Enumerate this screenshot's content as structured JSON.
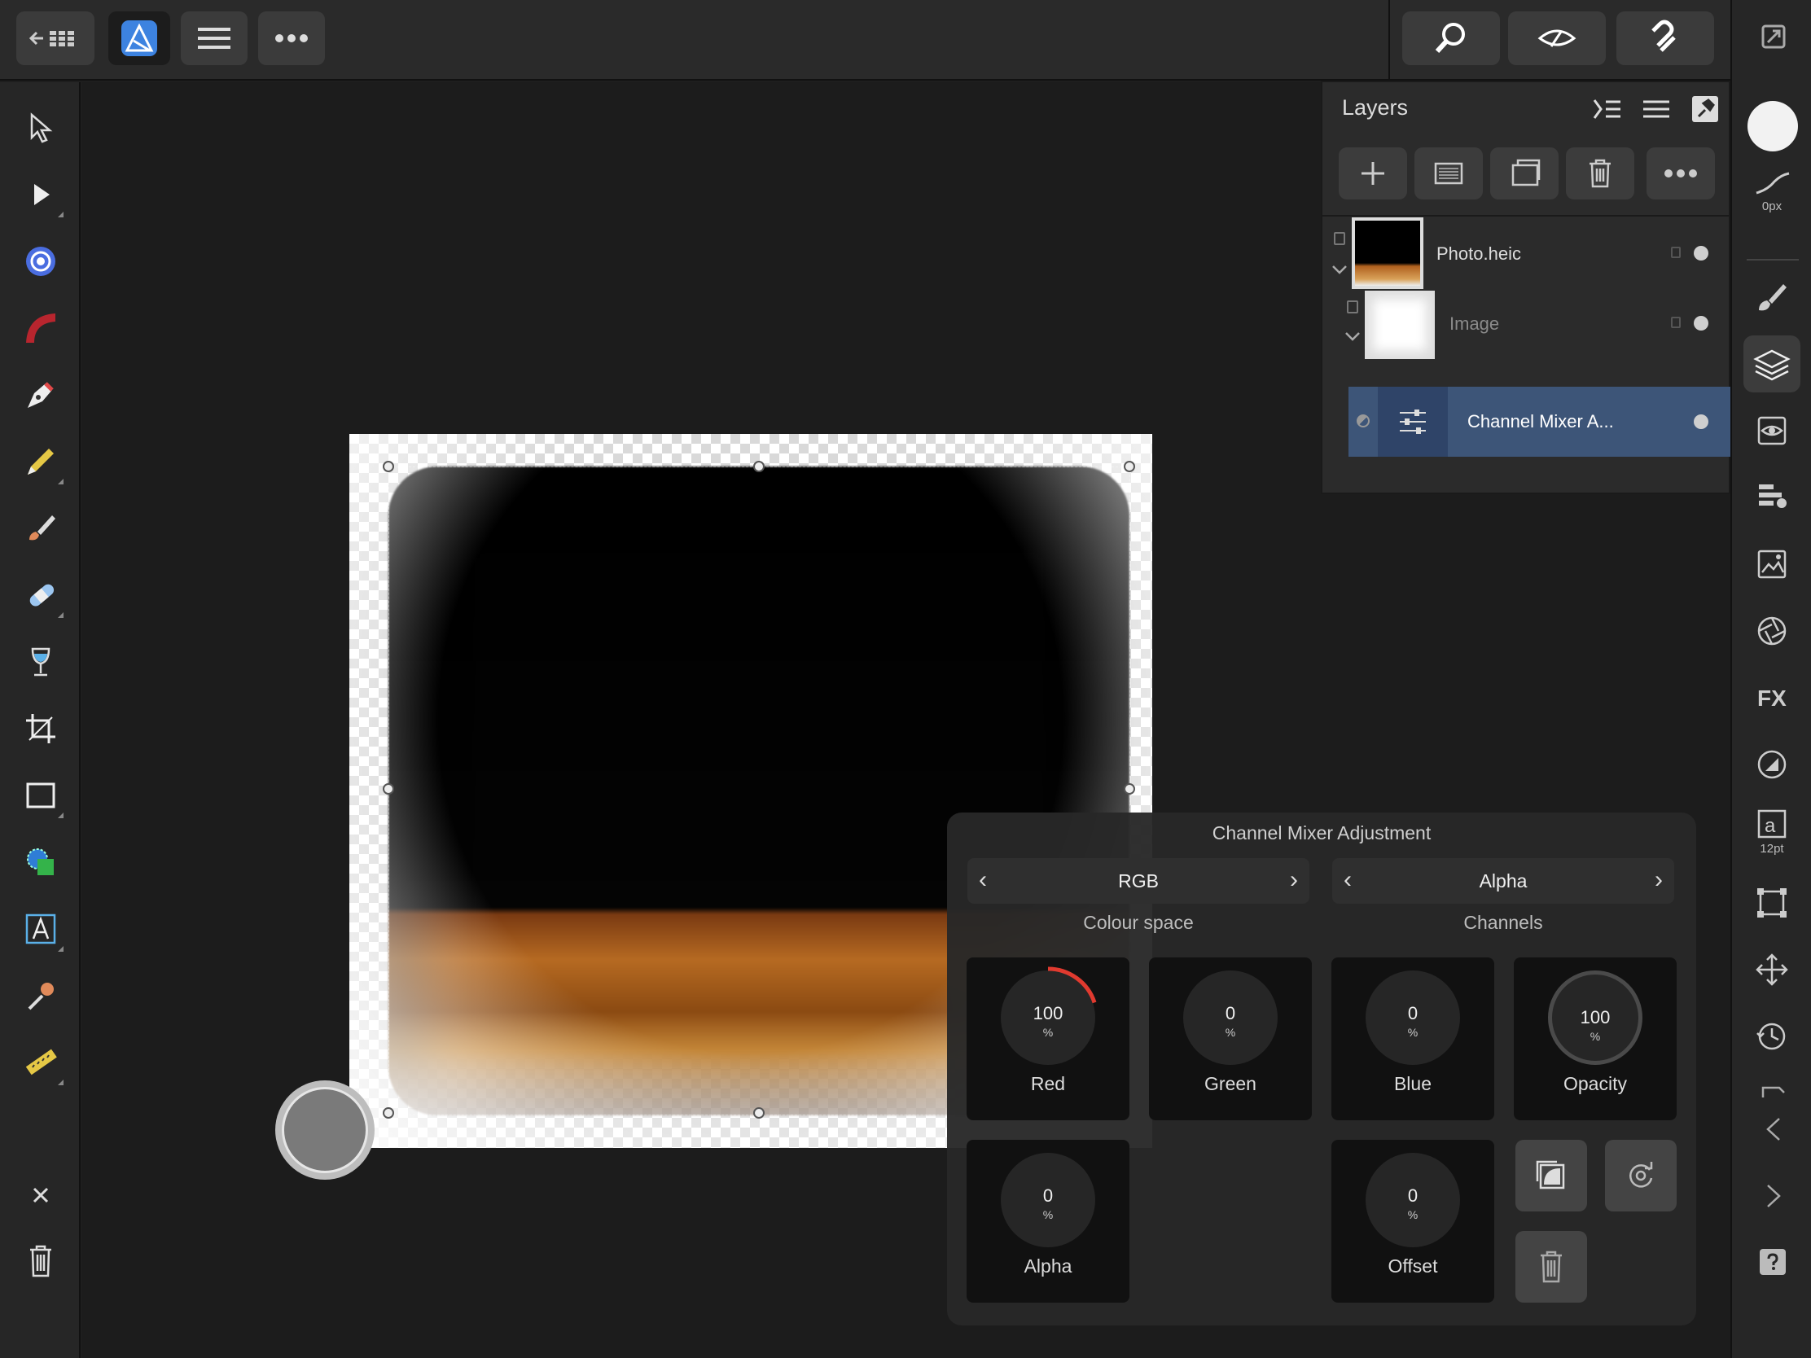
{
  "layers_panel": {
    "title": "Layers",
    "items": [
      {
        "name": "Photo.heic"
      },
      {
        "name": "Image"
      },
      {
        "name": "Channel Mixer A..."
      }
    ]
  },
  "right_bar": {
    "stroke_width": "0px",
    "text_size": "12pt"
  },
  "channel_mixer": {
    "title": "Channel Mixer Adjustment",
    "colour_space": {
      "value": "RGB",
      "caption": "Colour space"
    },
    "channels": {
      "value": "Alpha",
      "caption": "Channels"
    },
    "knobs": [
      {
        "label": "Red",
        "value": "100",
        "unit": "%",
        "level": 0.2
      },
      {
        "label": "Green",
        "value": "0",
        "unit": "%",
        "level": 0
      },
      {
        "label": "Blue",
        "value": "0",
        "unit": "%",
        "level": 0
      },
      {
        "label": "Opacity",
        "value": "100",
        "unit": "%",
        "level": 1
      },
      {
        "label": "Alpha",
        "value": "0",
        "unit": "%",
        "level": 0
      },
      {
        "label": "Offset",
        "value": "0",
        "unit": "%",
        "level": 0
      }
    ]
  },
  "colors": {
    "accent": "#3d83e0",
    "selected_layer": "#3d5578",
    "red_knob": "#e03a2f"
  }
}
